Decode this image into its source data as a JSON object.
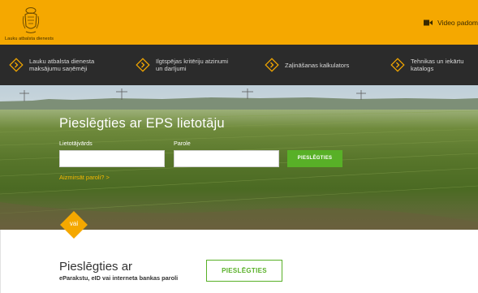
{
  "header": {
    "logo_text": "Lauku atbalsta dienests",
    "video_link": "Video padom"
  },
  "nav": {
    "items": [
      {
        "label": "Lauku atbalsta dienesta maksājumu saņēmēji",
        "icon": "chevron-right-icon"
      },
      {
        "label": "Ilgtspējas kritēriju atzinumi un darījumi",
        "icon": "chevron-right-icon"
      },
      {
        "label": "Zaļināšanas kalkulators",
        "icon": "chevron-right-icon"
      },
      {
        "label": "Tehnikas un iekārtu katalogs",
        "icon": "chevron-right-icon"
      }
    ]
  },
  "login": {
    "title": "Pieslēgties ar EPS lietotāju",
    "username_label": "Lietotājvārds",
    "username_value": "",
    "password_label": "Parole",
    "password_value": "",
    "submit_label": "PIESLĒGTIES",
    "forgot_label": "Aizmirsāt paroli?  >"
  },
  "divider": {
    "label": "vai"
  },
  "alt_login": {
    "title": "Pieslēgties ar",
    "subtitle": "eParakstu, eID vai interneta bankas paroli",
    "button_label": "PIESLĒGTIES"
  },
  "colors": {
    "brand_orange": "#f5a800",
    "nav_dark": "#2b2b2b",
    "accent_green": "#58b027"
  }
}
